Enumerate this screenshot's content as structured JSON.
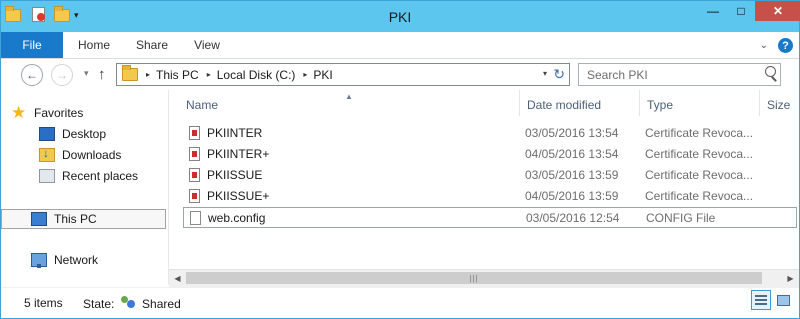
{
  "window": {
    "title": "PKI",
    "controls": {
      "minimize": "—",
      "maximize": "□",
      "close": "✕"
    }
  },
  "quick_access": {
    "customize": "▾"
  },
  "ribbon": {
    "tabs": [
      "File",
      "Home",
      "Share",
      "View"
    ],
    "expand": "⌄",
    "help": "?"
  },
  "navbar": {
    "back": "←",
    "forward": "→",
    "recent": "▾",
    "up": "↑",
    "breadcrumb": [
      "This PC",
      "Local Disk (C:)",
      "PKI"
    ],
    "separator": "▸",
    "dropdown": "▾",
    "refresh": "↻",
    "search_placeholder": "Search PKI"
  },
  "nav_pane": {
    "favorites": "Favorites",
    "items": [
      "Desktop",
      "Downloads",
      "Recent places"
    ],
    "this_pc": "This PC",
    "network": "Network"
  },
  "columns": {
    "name": "Name",
    "date": "Date modified",
    "type": "Type",
    "size": "Size",
    "sort_indicator": "▲"
  },
  "files": [
    {
      "name": "PKIINTER",
      "date": "03/05/2016 13:54",
      "type": "Certificate Revoca...",
      "icon": "certificate-revocation-list-icon"
    },
    {
      "name": "PKIINTER+",
      "date": "04/05/2016 13:54",
      "type": "Certificate Revoca...",
      "icon": "certificate-revocation-list-icon"
    },
    {
      "name": "PKIISSUE",
      "date": "03/05/2016 13:59",
      "type": "Certificate Revoca...",
      "icon": "certificate-revocation-list-icon"
    },
    {
      "name": "PKIISSUE+",
      "date": "04/05/2016 13:59",
      "type": "Certificate Revoca...",
      "icon": "certificate-revocation-list-icon"
    },
    {
      "name": "web.config",
      "date": "03/05/2016 12:54",
      "type": "CONFIG File",
      "icon": "config-file-icon"
    }
  ],
  "scrollbar": {
    "left": "◀",
    "right": "▶",
    "grip": "|||"
  },
  "status": {
    "count": "5 items",
    "state_label": "State:",
    "state_value": "Shared"
  },
  "colors": {
    "titlebar": "#5cc6ee",
    "file_tab": "#1979ca",
    "close_button": "#c7504a",
    "column_header_text": "#4c607a"
  }
}
